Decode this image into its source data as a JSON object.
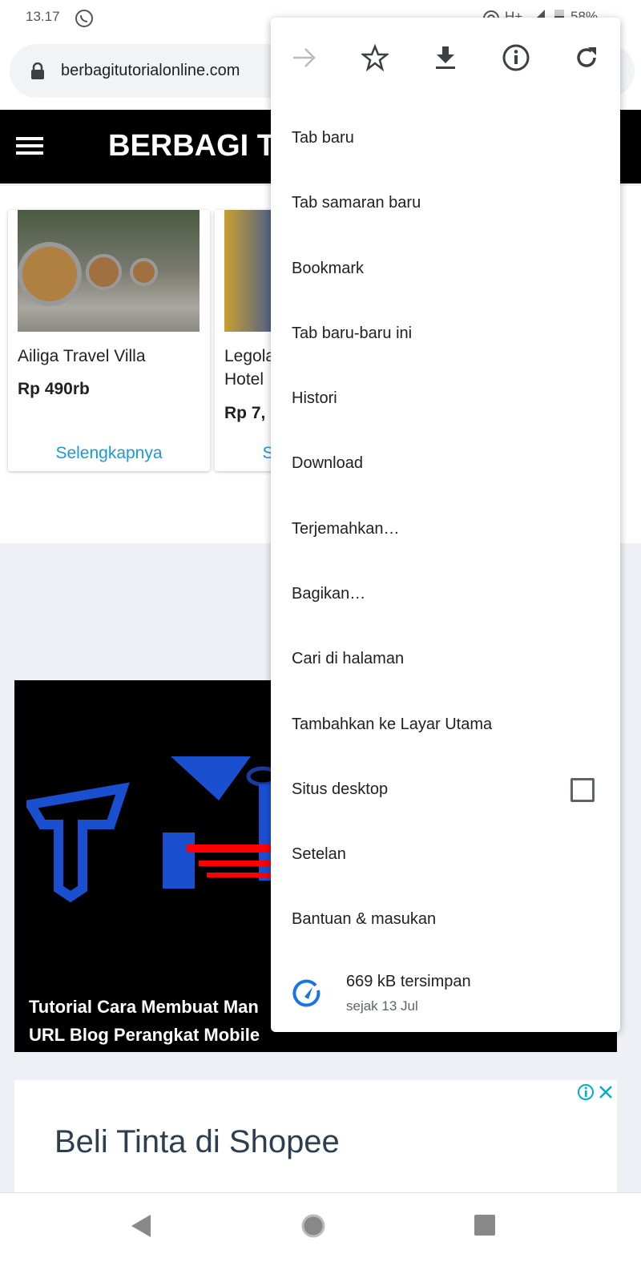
{
  "status": {
    "time": "13.17",
    "network": "H+",
    "battery": "58%"
  },
  "browser": {
    "url": "berbagitutorialonline.com"
  },
  "site": {
    "title": "BERBAGI TUTORIAL ONLINE"
  },
  "cards": [
    {
      "name": "Ailiga Travel Villa",
      "price": "Rp 490rb",
      "more": "Selengkapnya"
    },
    {
      "name": "Legoland Hotel",
      "price": "Rp 7,",
      "more": "Selengkapnya"
    }
  ],
  "article": {
    "caption_line1": "Tutorial Cara Membuat Man",
    "caption_line2": "URL Blog Perangkat Mobile"
  },
  "ad": {
    "title": "Beli Tinta di Shopee"
  },
  "menu": {
    "icons": [
      "forward-icon",
      "star-icon",
      "download-icon",
      "info-icon",
      "refresh-icon"
    ],
    "items": [
      {
        "label": "Tab baru"
      },
      {
        "label": "Tab samaran baru"
      },
      {
        "label": "Bookmark"
      },
      {
        "label": "Tab baru-baru ini"
      },
      {
        "label": "Histori"
      },
      {
        "label": "Download"
      },
      {
        "label": "Terjemahkan…"
      },
      {
        "label": "Bagikan…"
      },
      {
        "label": "Cari di halaman"
      },
      {
        "label": "Tambahkan ke Layar Utama"
      },
      {
        "label": "Situs desktop",
        "checkbox": false
      },
      {
        "label": "Setelan"
      },
      {
        "label": "Bantuan & masukan"
      }
    ],
    "savings": {
      "amount": "669 kB tersimpan",
      "since": "sejak 13 Jul"
    }
  },
  "colors": {
    "accent": "#1a73e8",
    "link": "#1a9ad6"
  }
}
